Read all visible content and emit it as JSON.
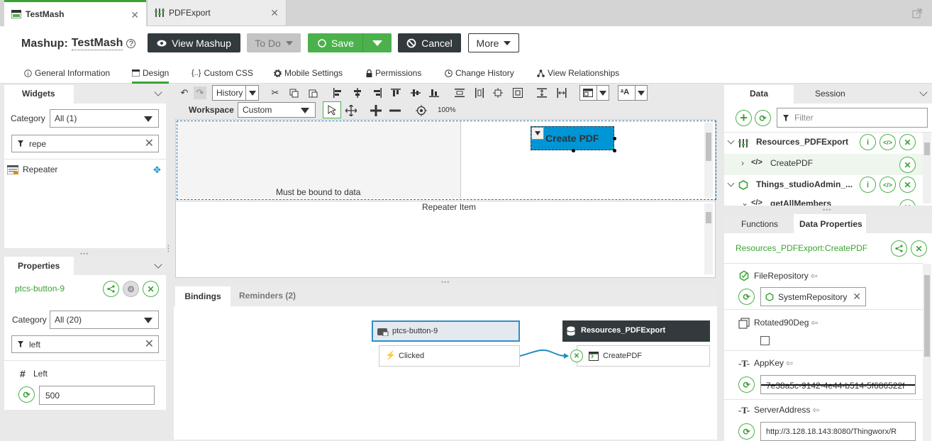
{
  "tabs": [
    {
      "label": "TestMash"
    },
    {
      "label": "PDFExport"
    }
  ],
  "header": {
    "title_prefix": "Mashup:",
    "title_name": "TestMash",
    "help_glyph": "?",
    "buttons": {
      "view_mashup": "View Mashup",
      "todo": "To Do",
      "save": "Save",
      "cancel": "Cancel",
      "more": "More"
    }
  },
  "subtabs": [
    {
      "label": "General Information",
      "icon": "info-icon"
    },
    {
      "label": "Design",
      "icon": "design-icon"
    },
    {
      "label": "Custom CSS",
      "icon": "css-icon"
    },
    {
      "label": "Mobile Settings",
      "icon": "gear-icon"
    },
    {
      "label": "Permissions",
      "icon": "lock-icon"
    },
    {
      "label": "Change History",
      "icon": "clock-icon"
    },
    {
      "label": "View Relationships",
      "icon": "relationships-icon"
    }
  ],
  "widgets": {
    "title": "Widgets",
    "category_label": "Category",
    "category_value": "All (1)",
    "filter_value": "repe",
    "items": [
      {
        "label": "Repeater"
      }
    ]
  },
  "properties": {
    "title": "Properties",
    "widget_id": "ptcs-button-9",
    "category_label": "Category",
    "category_value": "All (20)",
    "filter_value": "left",
    "prop_label": "Left",
    "prop_value": "500"
  },
  "toolbar": {
    "history_label": "History",
    "workspace_label": "Workspace",
    "workspace_value": "Custom",
    "zoom": "100%"
  },
  "canvas": {
    "bound_text": "Must be bound to data",
    "button_label": "Create PDF",
    "repeater_item": "Repeater Item"
  },
  "bottom": {
    "tab_bindings": "Bindings",
    "tab_reminders": "Reminders (2)",
    "source_name": "ptcs-button-9",
    "source_event": "Clicked",
    "target_name": "Resources_PDFExport",
    "target_service": "CreatePDF"
  },
  "data_panel": {
    "tab_data": "Data",
    "tab_session": "Session",
    "filter_placeholder": "Filter",
    "items": [
      {
        "label": "Resources_PDFExport"
      },
      {
        "label": "CreatePDF"
      },
      {
        "label": "Things_studioAdmin_..."
      },
      {
        "label": "getAllMembers"
      }
    ]
  },
  "data_props": {
    "tab_functions": "Functions",
    "tab_data_properties": "Data Properties",
    "service_path": "Resources_PDFExport:CreatePDF",
    "arrow_glyph": "⇦",
    "fields": [
      {
        "label": "FileRepository",
        "value": "SystemRepository"
      },
      {
        "label": "Rotated90Deg"
      },
      {
        "label": "AppKey",
        "value": "7e38a5c-9142-4e44-b514-5f686522f"
      },
      {
        "label": "ServerAddress",
        "value": "http://3.128.18.143:8080/Thingworx/R"
      }
    ]
  },
  "colors": {
    "accent": "#4cb14c",
    "dark": "#333a3d",
    "selection": "#0096d6",
    "link": "#2d6d9d"
  }
}
